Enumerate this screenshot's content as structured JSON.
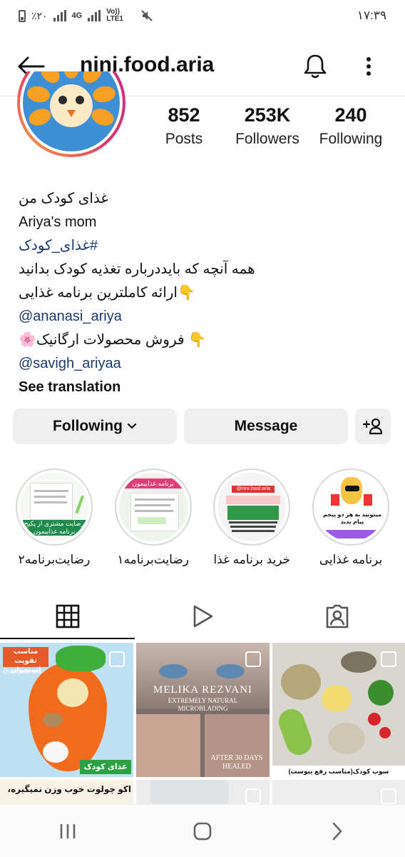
{
  "status": {
    "left_text": "٪۲۰",
    "net1": "4G",
    "net2": "Vo)) LTE1",
    "time": "۱۷:۳۹"
  },
  "header": {
    "username": "nini.food.aria"
  },
  "stats": [
    {
      "num": "852",
      "label": "Posts"
    },
    {
      "num": "253K",
      "label": "Followers"
    },
    {
      "num": "240",
      "label": "Following"
    }
  ],
  "bio": {
    "line1": "غذای کودک من",
    "line2": "Ariya's mom",
    "line3": "#غذای_کودک",
    "line4": "همه آنچه که بایددرباره تغذیه کودک بدانید",
    "line5": "👇ارائه کاملترین برنامه غذایی",
    "line6": "@ananasi_ariya",
    "line7": "👇 فروش محصولات ارگانیک🌸",
    "line8": "@savigh_ariyaa",
    "see_translation": "See translation"
  },
  "actions": {
    "following": "Following",
    "message": "Message"
  },
  "highlights": [
    {
      "label": "رضایت‌برنامه۲",
      "cover_text": "رضایت مشتری از پکیج برنامه غذاییمون"
    },
    {
      "label": "رضایت‌برنامه۱",
      "cover_text": "برنامه غذاییمون"
    },
    {
      "label": "خرید برنامه غذا",
      "cover_text": "@nini.food.aria"
    },
    {
      "label": "برنامه غذایی",
      "cover_text": "میتونید به هر دو پیجم پیام بدید"
    }
  ],
  "posts": [
    {
      "caption": "مناسب تقویت استخوان",
      "bottom": "غذای کودک",
      "handle": "@nini.food.aria"
    },
    {
      "caption": "MELIKA REZVANI",
      "sub": "EXTREMELY NATURAL MICROBLADING",
      "bottom": "AFTER 30 DAYS HEALED"
    },
    {
      "caption": "سوپ کودک(مناسب رفع یبوست)"
    },
    {
      "caption": "اکو چولوت خوب وزن نمیگیره،"
    }
  ],
  "colors": {
    "link": "#1a3a6e",
    "button_bg": "#efefef",
    "ring_gradient_start": "#f9a63a",
    "ring_gradient_end": "#c13584"
  }
}
